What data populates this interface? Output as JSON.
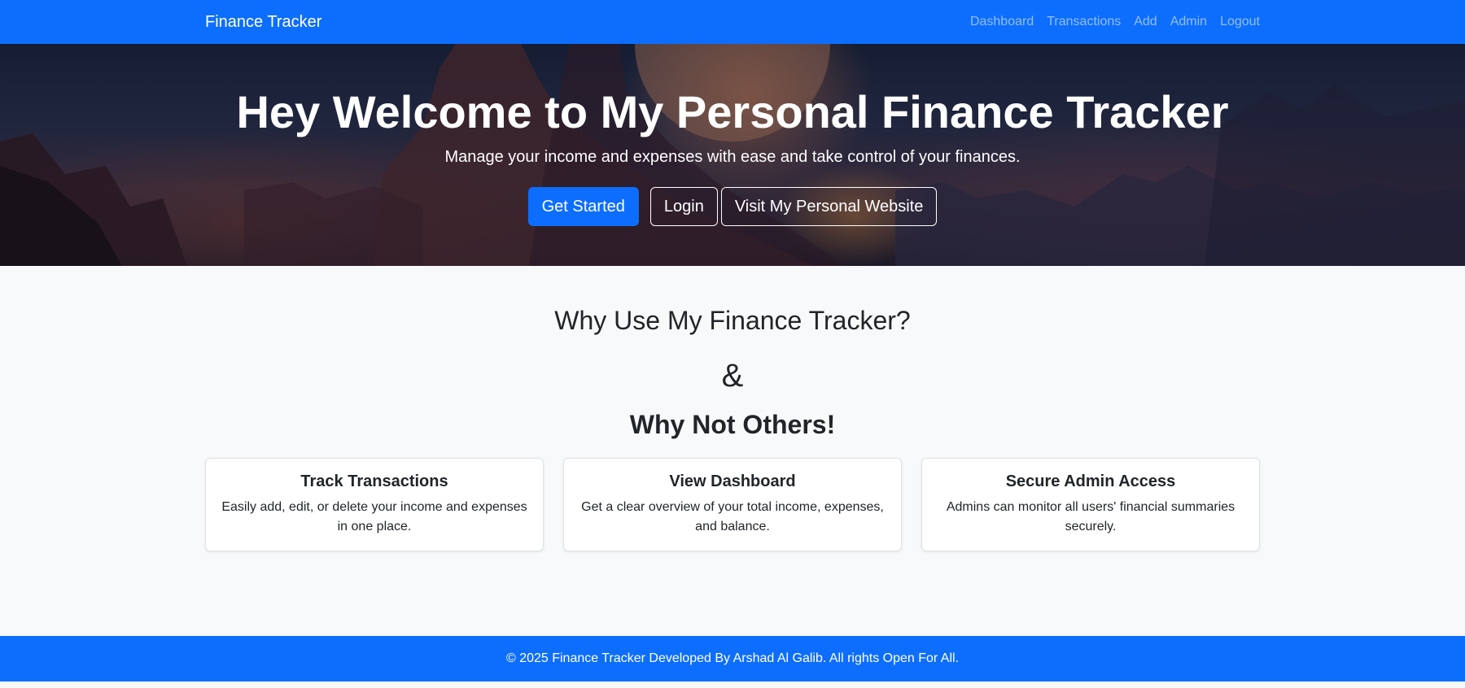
{
  "navbar": {
    "brand": "Finance Tracker",
    "links": [
      "Dashboard",
      "Transactions",
      "Add",
      "Admin",
      "Logout"
    ]
  },
  "hero": {
    "title": "Hey Welcome to My Personal Finance Tracker",
    "subtitle": "Manage your income and expenses with ease and take control of your finances.",
    "buttons": {
      "get_started": "Get Started",
      "login": "Login",
      "website": "Visit My Personal Website"
    }
  },
  "features": {
    "heading": "Why Use My Finance Tracker?",
    "amp": "&",
    "subheading": "Why Not Others!",
    "cards": [
      {
        "title": "Track Transactions",
        "text": "Easily add, edit, or delete your income and expenses in one place."
      },
      {
        "title": "View Dashboard",
        "text": "Get a clear overview of your total income, expenses, and balance."
      },
      {
        "title": "Secure Admin Access",
        "text": "Admins can monitor all users' financial summaries securely."
      }
    ]
  },
  "footer": {
    "text": "© 2025 Finance Tracker Developed By Arshad Al Galib. All rights Open For All."
  },
  "colors": {
    "primary": "#0d6efd",
    "background": "#f8f9fa"
  }
}
